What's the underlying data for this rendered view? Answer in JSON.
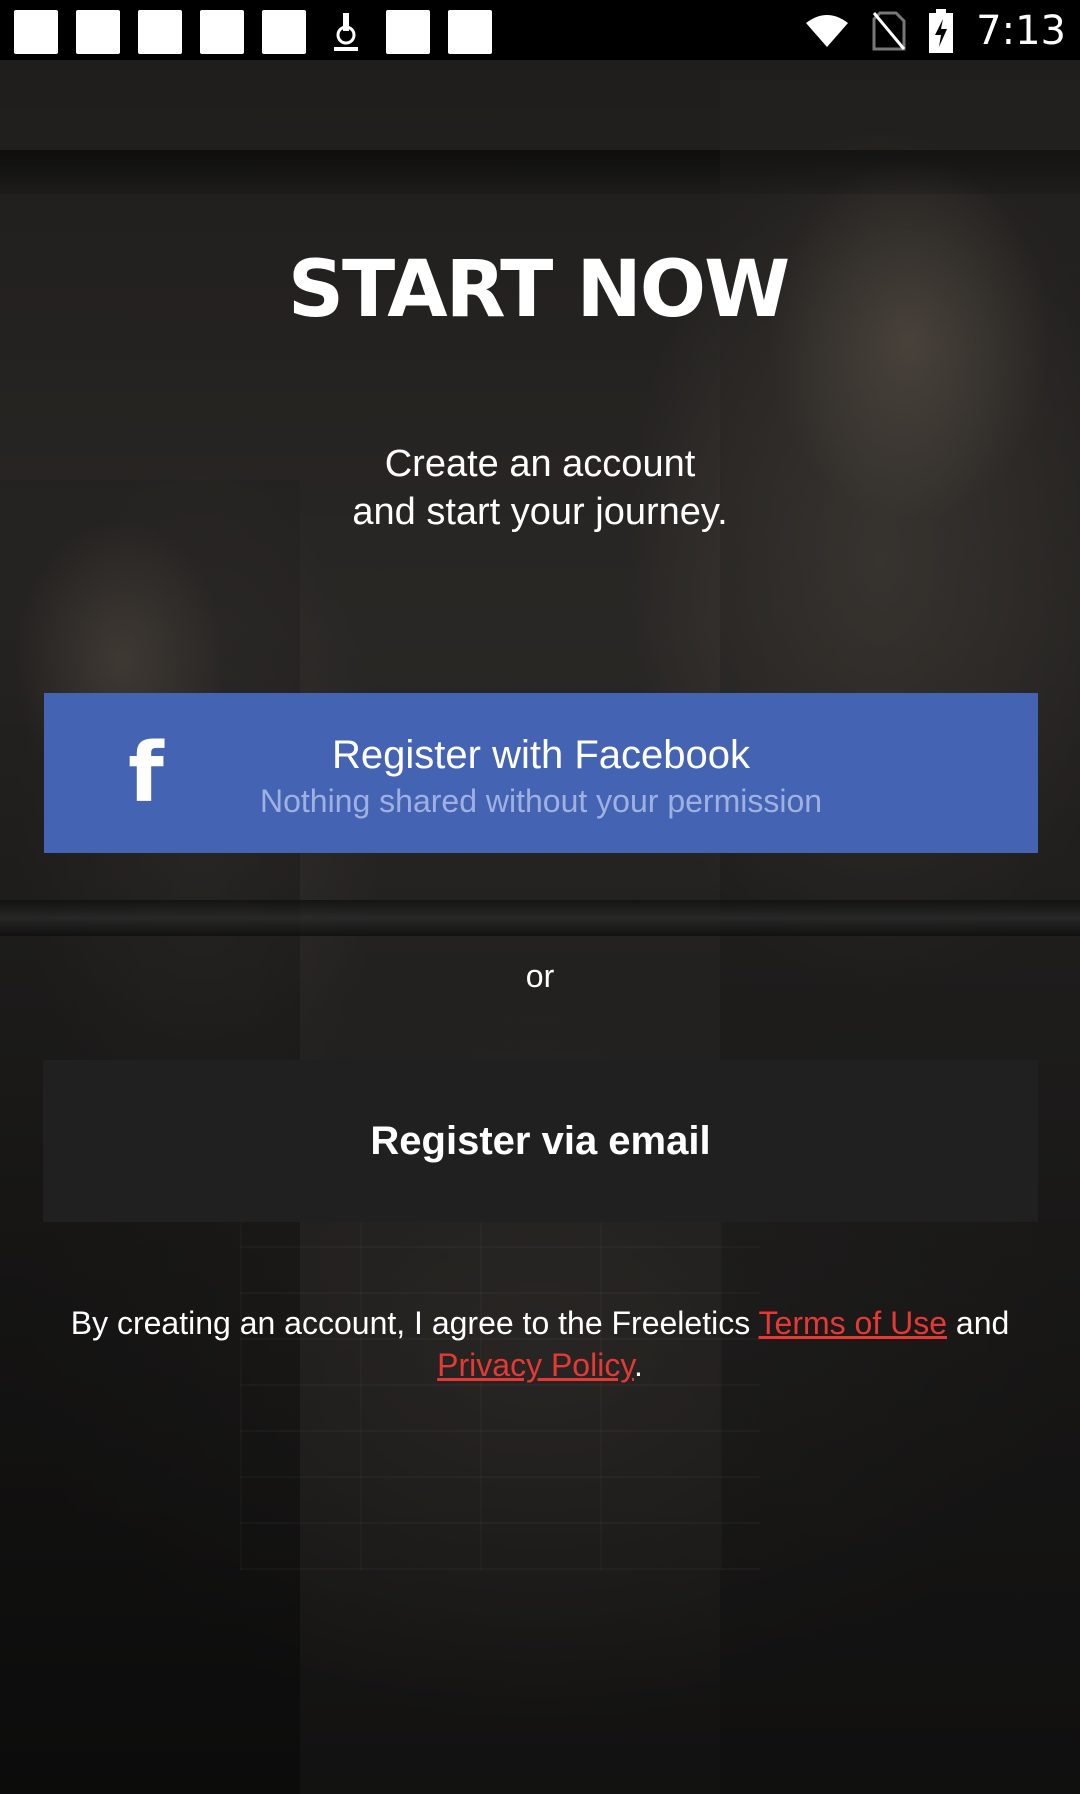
{
  "status_bar": {
    "time": "7:13",
    "icons": [
      "notification-icon",
      "notification-icon",
      "notification-icon",
      "notification-icon",
      "microscope-icon",
      "notification-icon",
      "notification-icon",
      "wifi-icon",
      "no-sim-icon",
      "battery-charging-icon"
    ]
  },
  "hero": {
    "title": "START NOW",
    "subtitle_line1": "Create an account",
    "subtitle_line2": "and start your journey."
  },
  "facebook_button": {
    "icon": "facebook-icon",
    "title": "Register with Facebook",
    "subtitle": "Nothing shared without your permission",
    "color": "#4563b3"
  },
  "divider": {
    "label": "or"
  },
  "email_button": {
    "label": "Register via email",
    "color": "#202020"
  },
  "legal": {
    "prefix": "By creating an account, I agree to the Freeletics ",
    "terms_link": "Terms of Use",
    "middle": " and ",
    "privacy_link": "Privacy Policy",
    "suffix": ".",
    "link_color": "#e53935"
  }
}
